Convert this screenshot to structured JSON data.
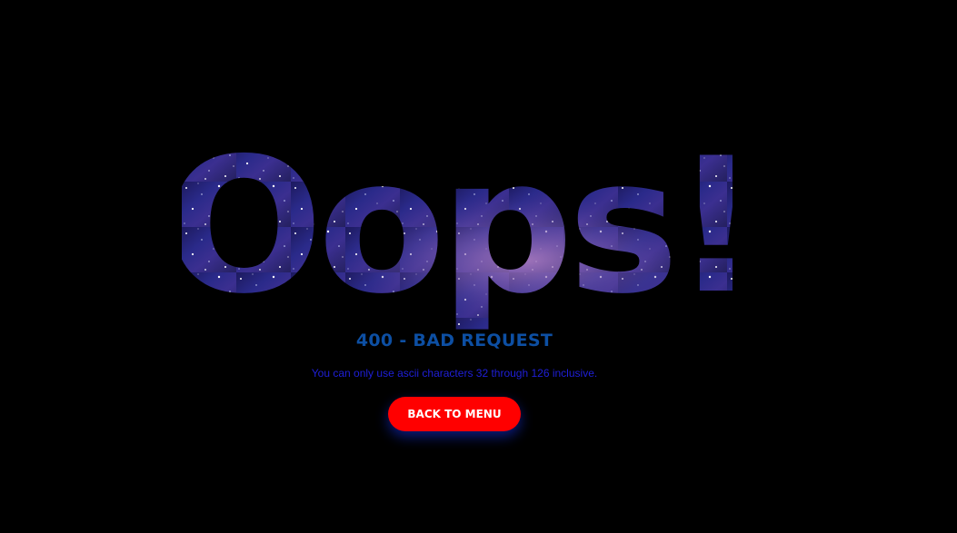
{
  "hero": {
    "text": "Oops!"
  },
  "error": {
    "title": "400 - BAD REQUEST",
    "message": "You can only use ascii characters 32 through 126 inclusive."
  },
  "actions": {
    "back_label": "BACK TO MENU"
  },
  "colors": {
    "background": "#000000",
    "title": "#0d4fa3",
    "message": "#1f1fd9",
    "button": "#ff0000",
    "button_text": "#ffffff"
  }
}
